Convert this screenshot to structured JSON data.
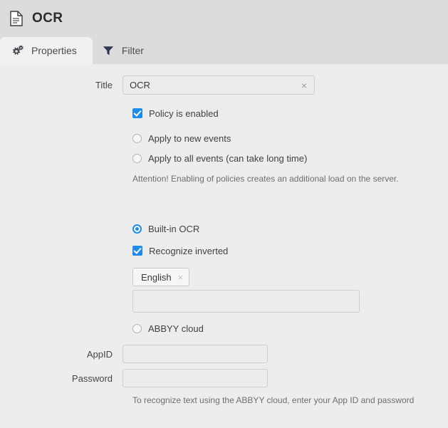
{
  "header": {
    "title": "OCR",
    "doc_icon": "document-icon"
  },
  "tabs": [
    {
      "label": "Properties",
      "icon": "gears-icon",
      "active": true
    },
    {
      "label": "Filter",
      "icon": "funnel-icon",
      "active": false
    }
  ],
  "form": {
    "title_label": "Title",
    "title_value": "OCR",
    "title_clear": "×",
    "policy_enabled_label": "Policy is enabled",
    "apply_new_label": "Apply to new events",
    "apply_all_label": "Apply to all events (can take long time)",
    "attention_note": "Attention! Enabling of policies creates an additional load on the server.",
    "builtin_ocr_label": "Built-in OCR",
    "recognize_inverted_label": "Recognize inverted",
    "language_chip": "English",
    "language_chip_remove": "×",
    "language_input_value": "",
    "abbyy_cloud_label": "ABBYY cloud",
    "appid_label": "AppID",
    "appid_value": "",
    "password_label": "Password",
    "password_value": "",
    "cloud_note": "To recognize text using the ABBYY cloud, enter your App ID and password"
  },
  "colors": {
    "accent": "#1f8ceb",
    "header_bg": "#dcdcdc",
    "body_bg": "#ededed",
    "active_tab_bg": "#f1f1f1"
  }
}
